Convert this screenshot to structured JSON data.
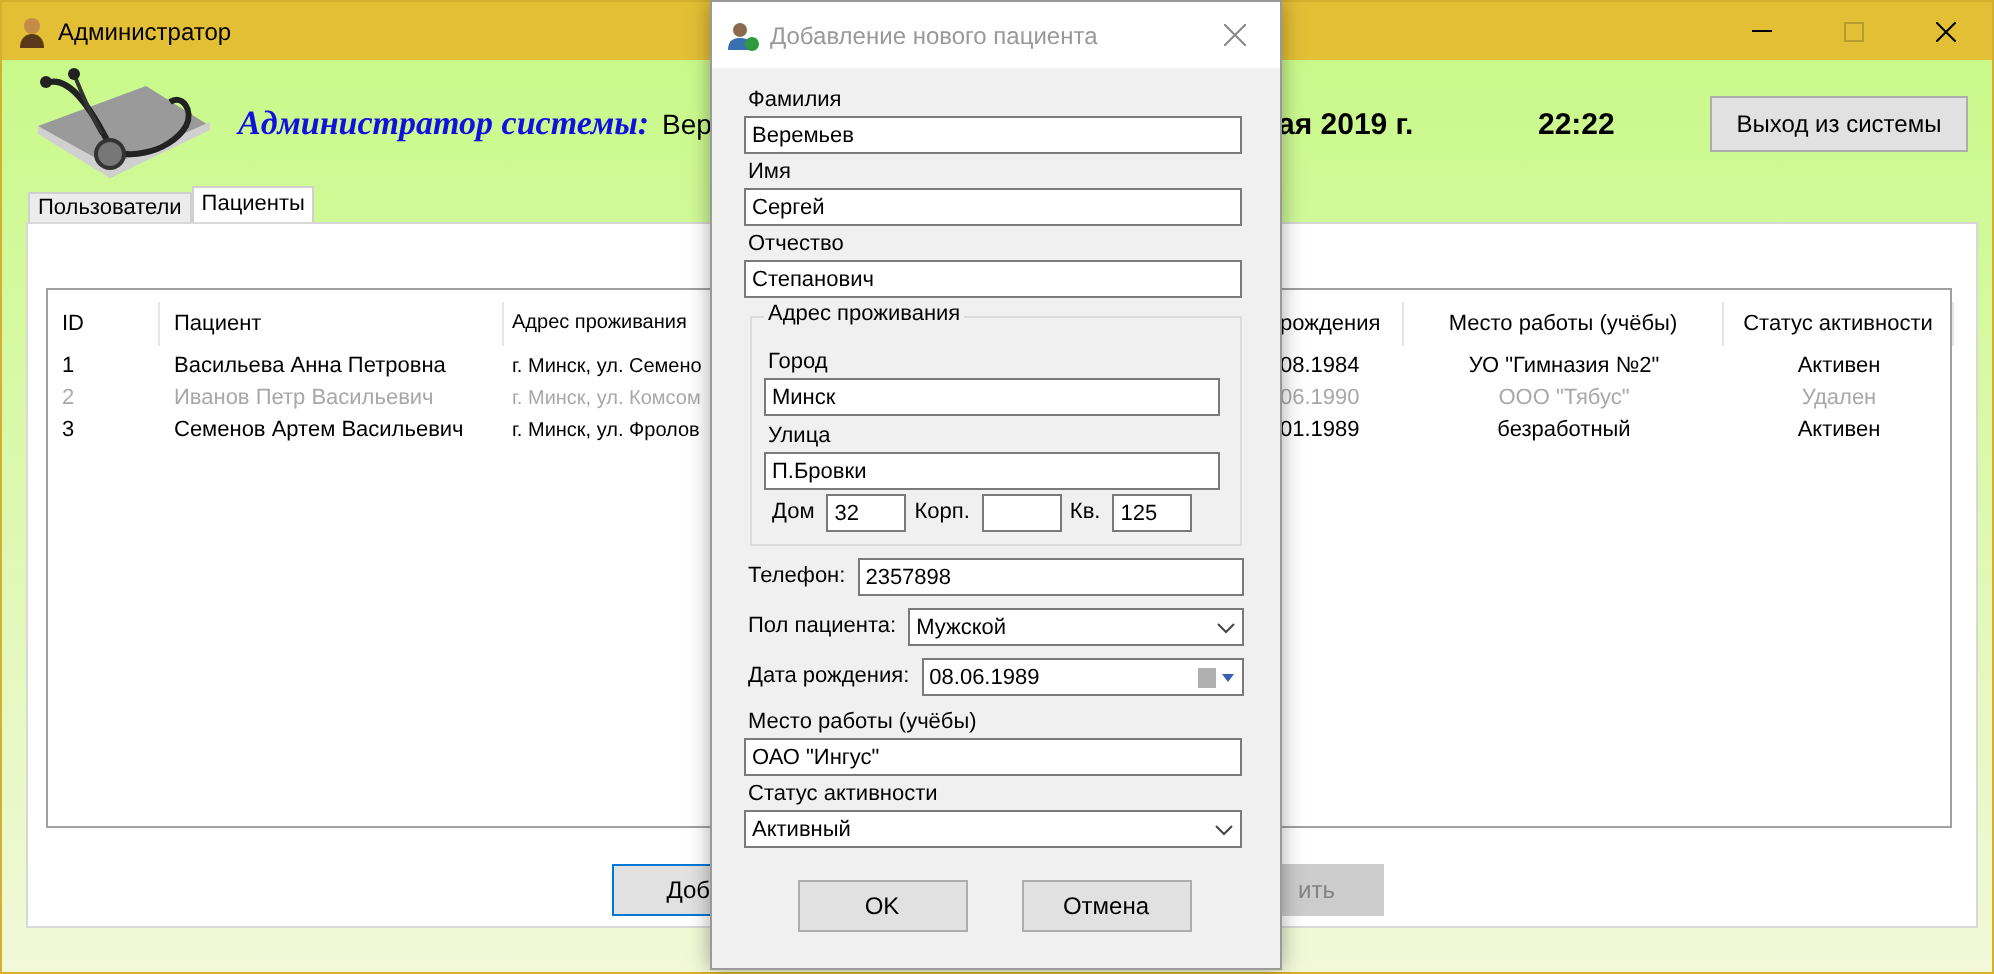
{
  "window": {
    "title": "Администратор"
  },
  "header": {
    "heading": "Администратор системы:",
    "user_name": "Вер",
    "date": "ая 2019 г.",
    "time": "22:22",
    "logout_button": "Выход из системы"
  },
  "tabs": [
    {
      "label": "Пользователи",
      "selected": false
    },
    {
      "label": "Пациенты",
      "selected": true
    }
  ],
  "table": {
    "columns": [
      {
        "label": "ID"
      },
      {
        "label": "Пациент"
      },
      {
        "label": "Адрес проживания"
      },
      {
        "label": "рождения"
      },
      {
        "label": "Место работы (учёбы)"
      },
      {
        "label": "Статус активности"
      }
    ],
    "rows": [
      {
        "disabled": false,
        "cells": [
          "1",
          "Васильева Анна Петровна",
          "г. Минск, ул. Семено",
          "08.1984",
          "УО \"Гимназия №2\"",
          "Активен"
        ]
      },
      {
        "disabled": true,
        "cells": [
          "2",
          "Иванов Петр Васильевич",
          "г. Минск, ул. Комсом",
          "06.1990",
          "ООО \"Тябус\"",
          "Удален"
        ]
      },
      {
        "disabled": false,
        "cells": [
          "3",
          "Семенов Артем Васильевич",
          "г. Минск, ул. Фролов",
          "01.1989",
          "безработный",
          "Активен"
        ]
      }
    ]
  },
  "buttons": [
    {
      "label": "Доб",
      "disabled": false
    },
    {
      "label": "ить",
      "disabled": true
    }
  ],
  "dialog": {
    "title": "Добавление нового пациента",
    "surname": {
      "label": "Фамилия",
      "value": "Веремьев"
    },
    "first_name": {
      "label": "Имя",
      "value": "Сергей"
    },
    "patronymic": {
      "label": "Отчество",
      "value": "Степанович"
    },
    "address": {
      "legend": "Адрес проживания",
      "city": {
        "label": "Город",
        "value": "Минск"
      },
      "street": {
        "label": "Улица",
        "value": "П.Бровки"
      },
      "house": {
        "label": "Дом",
        "value": "32"
      },
      "building": {
        "label": "Корп."
      },
      "flat": {
        "label": "Кв.",
        "value": "125"
      }
    },
    "phone": {
      "label": "Телефон:",
      "value": "2357898"
    },
    "gender": {
      "label": "Пол пациента:",
      "value": "Мужской"
    },
    "birth_date": {
      "label": "Дата рождения:",
      "value": "08.06.1989"
    },
    "workplace": {
      "label": "Место работы (учёбы)",
      "value": "ОАО \"Ингус\""
    },
    "status": {
      "label": "Статус активности",
      "value": "Активный"
    },
    "buttons": [
      "OK",
      "Отмена"
    ]
  }
}
